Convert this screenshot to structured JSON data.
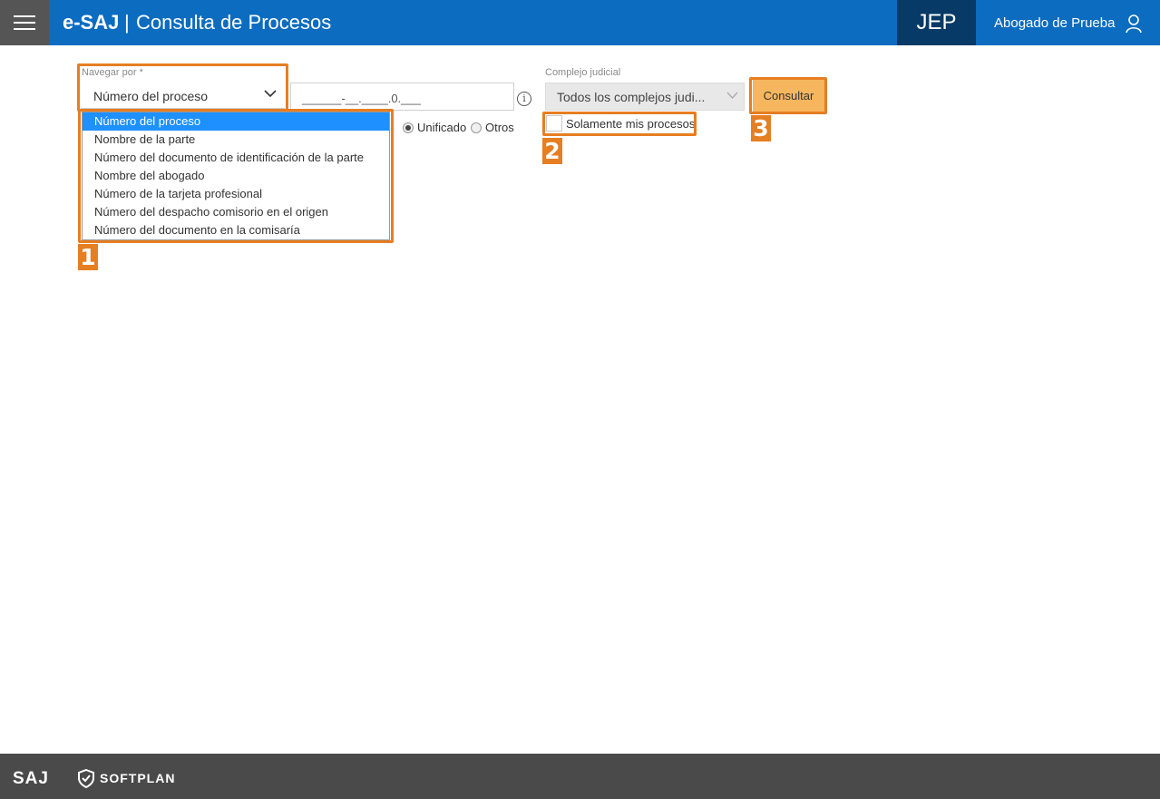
{
  "header": {
    "brand": "e-SAJ",
    "separator": "|",
    "title": "Consulta de Procesos",
    "court": "JEP",
    "user": "Abogado de Prueba"
  },
  "form": {
    "navigate_label": "Navegar por *",
    "navigate_value": "Número del proceso",
    "number_value": "______-__.____.0.___",
    "radio_unified": "Unificado",
    "radio_other": "Otros",
    "radio_selected": "Unificado",
    "dropdown_options": [
      "Número del proceso",
      "Nombre de la parte",
      "Número del documento de identificación de la parte",
      "Nombre del abogado",
      "Número de la tarjeta profesional",
      "Número del despacho comisorio en el origen",
      "Número del documento en la comisaría"
    ],
    "complex_label": "Complejo judicial",
    "complex_value": "Todos los complejos judi...",
    "only_mine_label": "Solamente mis procesos",
    "only_mine_checked": false,
    "submit_label": "Consultar"
  },
  "annotations": [
    "1",
    "2",
    "3"
  ],
  "footer": {
    "logo": "SAJ",
    "company": "SOFTPLAN"
  },
  "colors": {
    "header": "#0b6cc0",
    "court_bg": "#073a66",
    "highlight": "#e67e22",
    "button": "#f5b65e",
    "selected_option": "#1e90ff",
    "footer": "#4a4a4a"
  }
}
